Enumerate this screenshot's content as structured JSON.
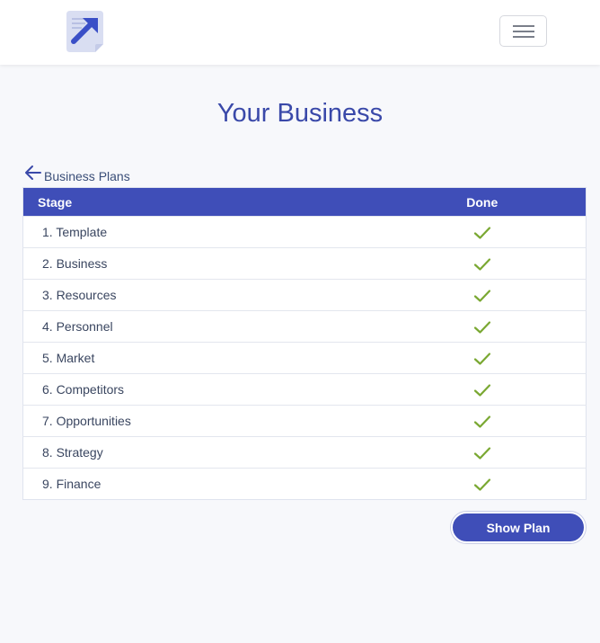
{
  "header": {
    "logo_icon": "arrow-document-logo-icon",
    "menu_icon": "hamburger-menu-icon"
  },
  "page": {
    "title": "Your Business"
  },
  "back_link": {
    "label": "Business Plans",
    "icon": "arrow-left-icon"
  },
  "table": {
    "headers": {
      "stage": "Stage",
      "done": "Done"
    },
    "rows": [
      {
        "label": "1. Template",
        "done": true
      },
      {
        "label": "2. Business",
        "done": true
      },
      {
        "label": "3. Resources",
        "done": true
      },
      {
        "label": "4. Personnel",
        "done": true
      },
      {
        "label": "5. Market",
        "done": true
      },
      {
        "label": "6. Competitors",
        "done": true
      },
      {
        "label": "7. Opportunities",
        "done": true
      },
      {
        "label": "8. Strategy",
        "done": true
      },
      {
        "label": "9. Finance",
        "done": true
      }
    ]
  },
  "actions": {
    "show_plan_label": "Show Plan"
  },
  "colors": {
    "accent": "#3f4eb8",
    "check": "#7aa832",
    "background": "#f7f8fb"
  }
}
